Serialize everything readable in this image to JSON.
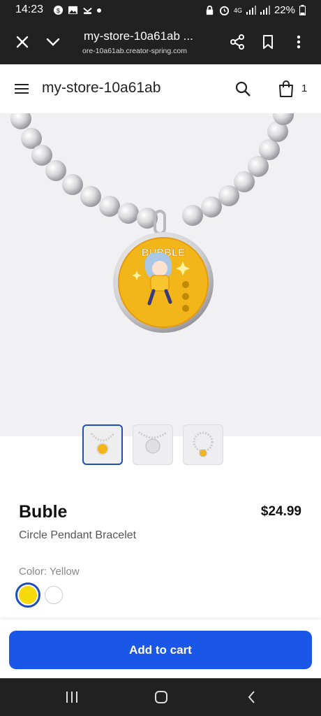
{
  "status": {
    "time": "14:23",
    "network": "4G",
    "battery": "22%"
  },
  "browser": {
    "title": "my-store-10a61ab ...",
    "url": "ore-10a61ab.creator-spring.com"
  },
  "site": {
    "store_name": "my-store-10a61ab",
    "cart_count": "1"
  },
  "product": {
    "name": "Buble",
    "type": "Circle Pendant Bracelet",
    "price": "$24.99",
    "color_label": "Color: Yellow",
    "pendant_text": "BUBBLE",
    "colors": [
      "#f5d90a",
      "#ffffff"
    ],
    "selected_color": "Yellow",
    "thumbnails": 3
  },
  "cart": {
    "add_label": "Add to cart"
  },
  "accent": "#1a56e8"
}
